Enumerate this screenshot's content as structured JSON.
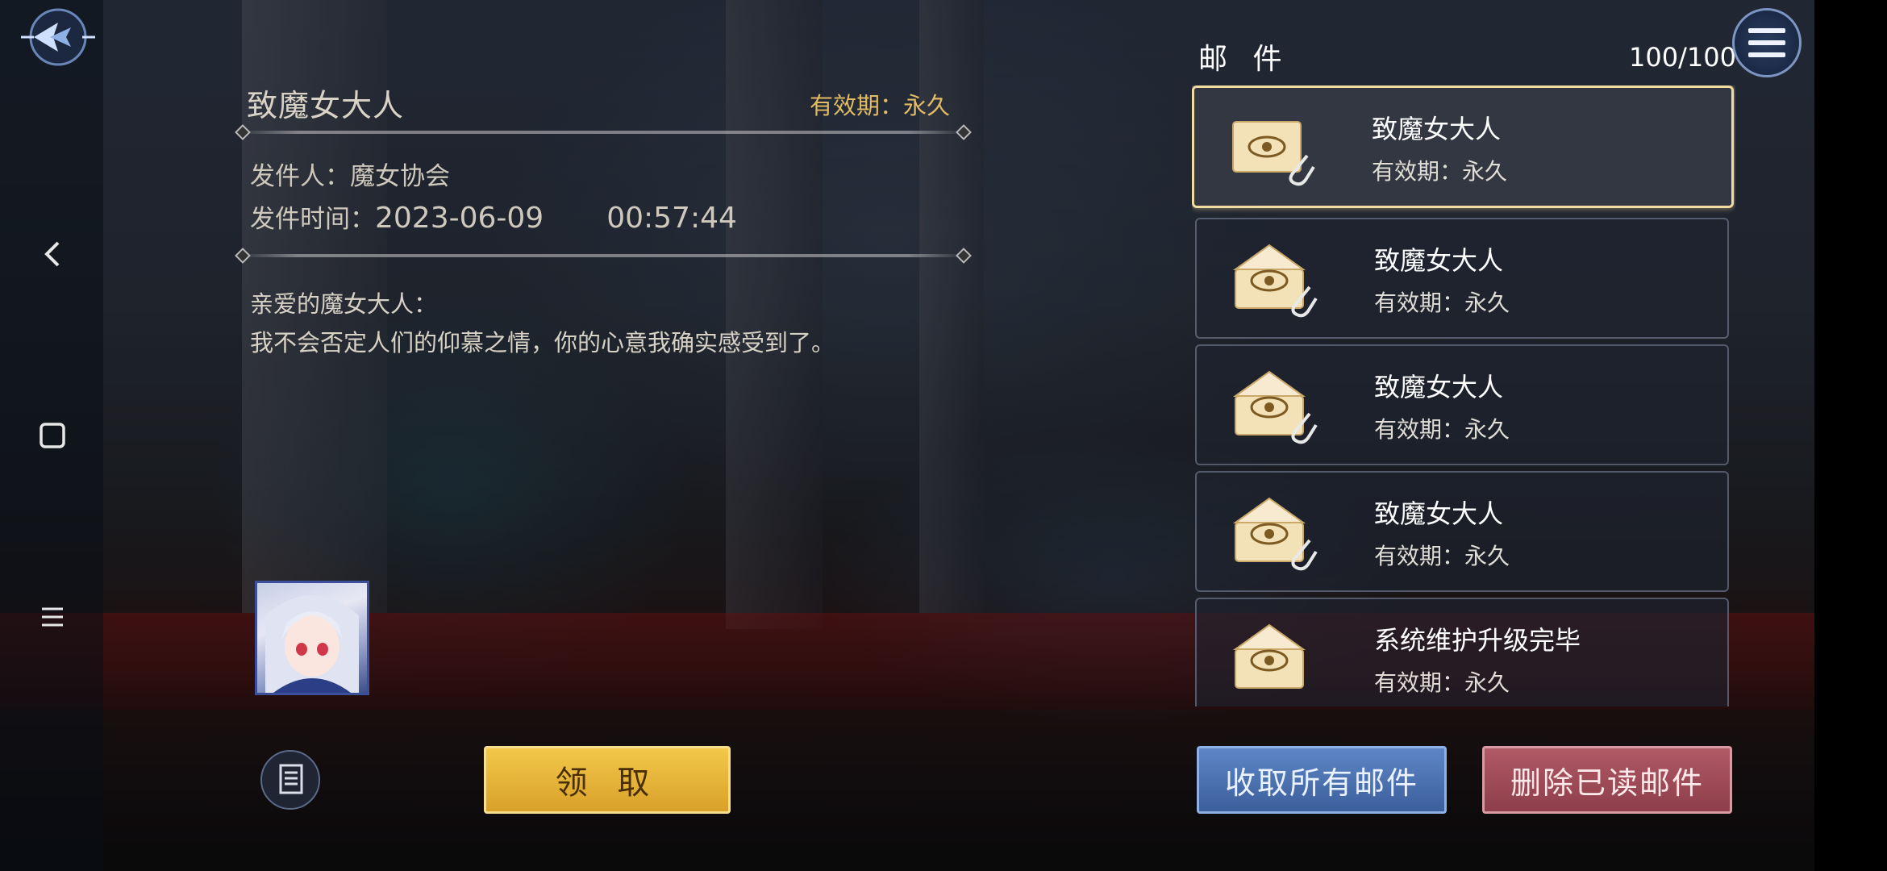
{
  "detail": {
    "title": "致魔女大人",
    "validity": "有效期：永久",
    "sender_label": "发件人：",
    "sender": "魔女协会",
    "time_label": "发件时间：",
    "date": "2023-06-09",
    "time": "00:57:44",
    "greeting": "亲爱的魔女大人：",
    "body": "我不会否定人们的仰慕之情，你的心意我确实感受到了。"
  },
  "buttons": {
    "claim": "领 取",
    "collect_all": "收取所有邮件",
    "delete_read": "删除已读邮件"
  },
  "mail_panel": {
    "header": "邮 件",
    "count": "100/100"
  },
  "mails": [
    {
      "title": "致魔女大人",
      "validity": "有效期：永久",
      "attachment": true,
      "opened": false
    },
    {
      "title": "致魔女大人",
      "validity": "有效期：永久",
      "attachment": true,
      "opened": true
    },
    {
      "title": "致魔女大人",
      "validity": "有效期：永久",
      "attachment": true,
      "opened": true
    },
    {
      "title": "致魔女大人",
      "validity": "有效期：永久",
      "attachment": true,
      "opened": true
    },
    {
      "title": "系统维护升级完毕",
      "validity": "有效期：永久",
      "attachment": false,
      "opened": true
    }
  ],
  "icons": {
    "back": "back-logo-icon",
    "nav_back": "chevron-left-icon",
    "nav_home": "square-icon",
    "nav_menu": "hamburger-icon",
    "menu": "menu-icon",
    "doc": "document-icon",
    "mail": "eye-envelope-icon",
    "attachment": "paperclip-icon"
  },
  "colors": {
    "accent_gold": "#e2bb63",
    "claim_button": "#f2c84a",
    "collect_button": "#4f76b5",
    "delete_button": "#9f4c58",
    "selected_border": "#f0dba0"
  }
}
